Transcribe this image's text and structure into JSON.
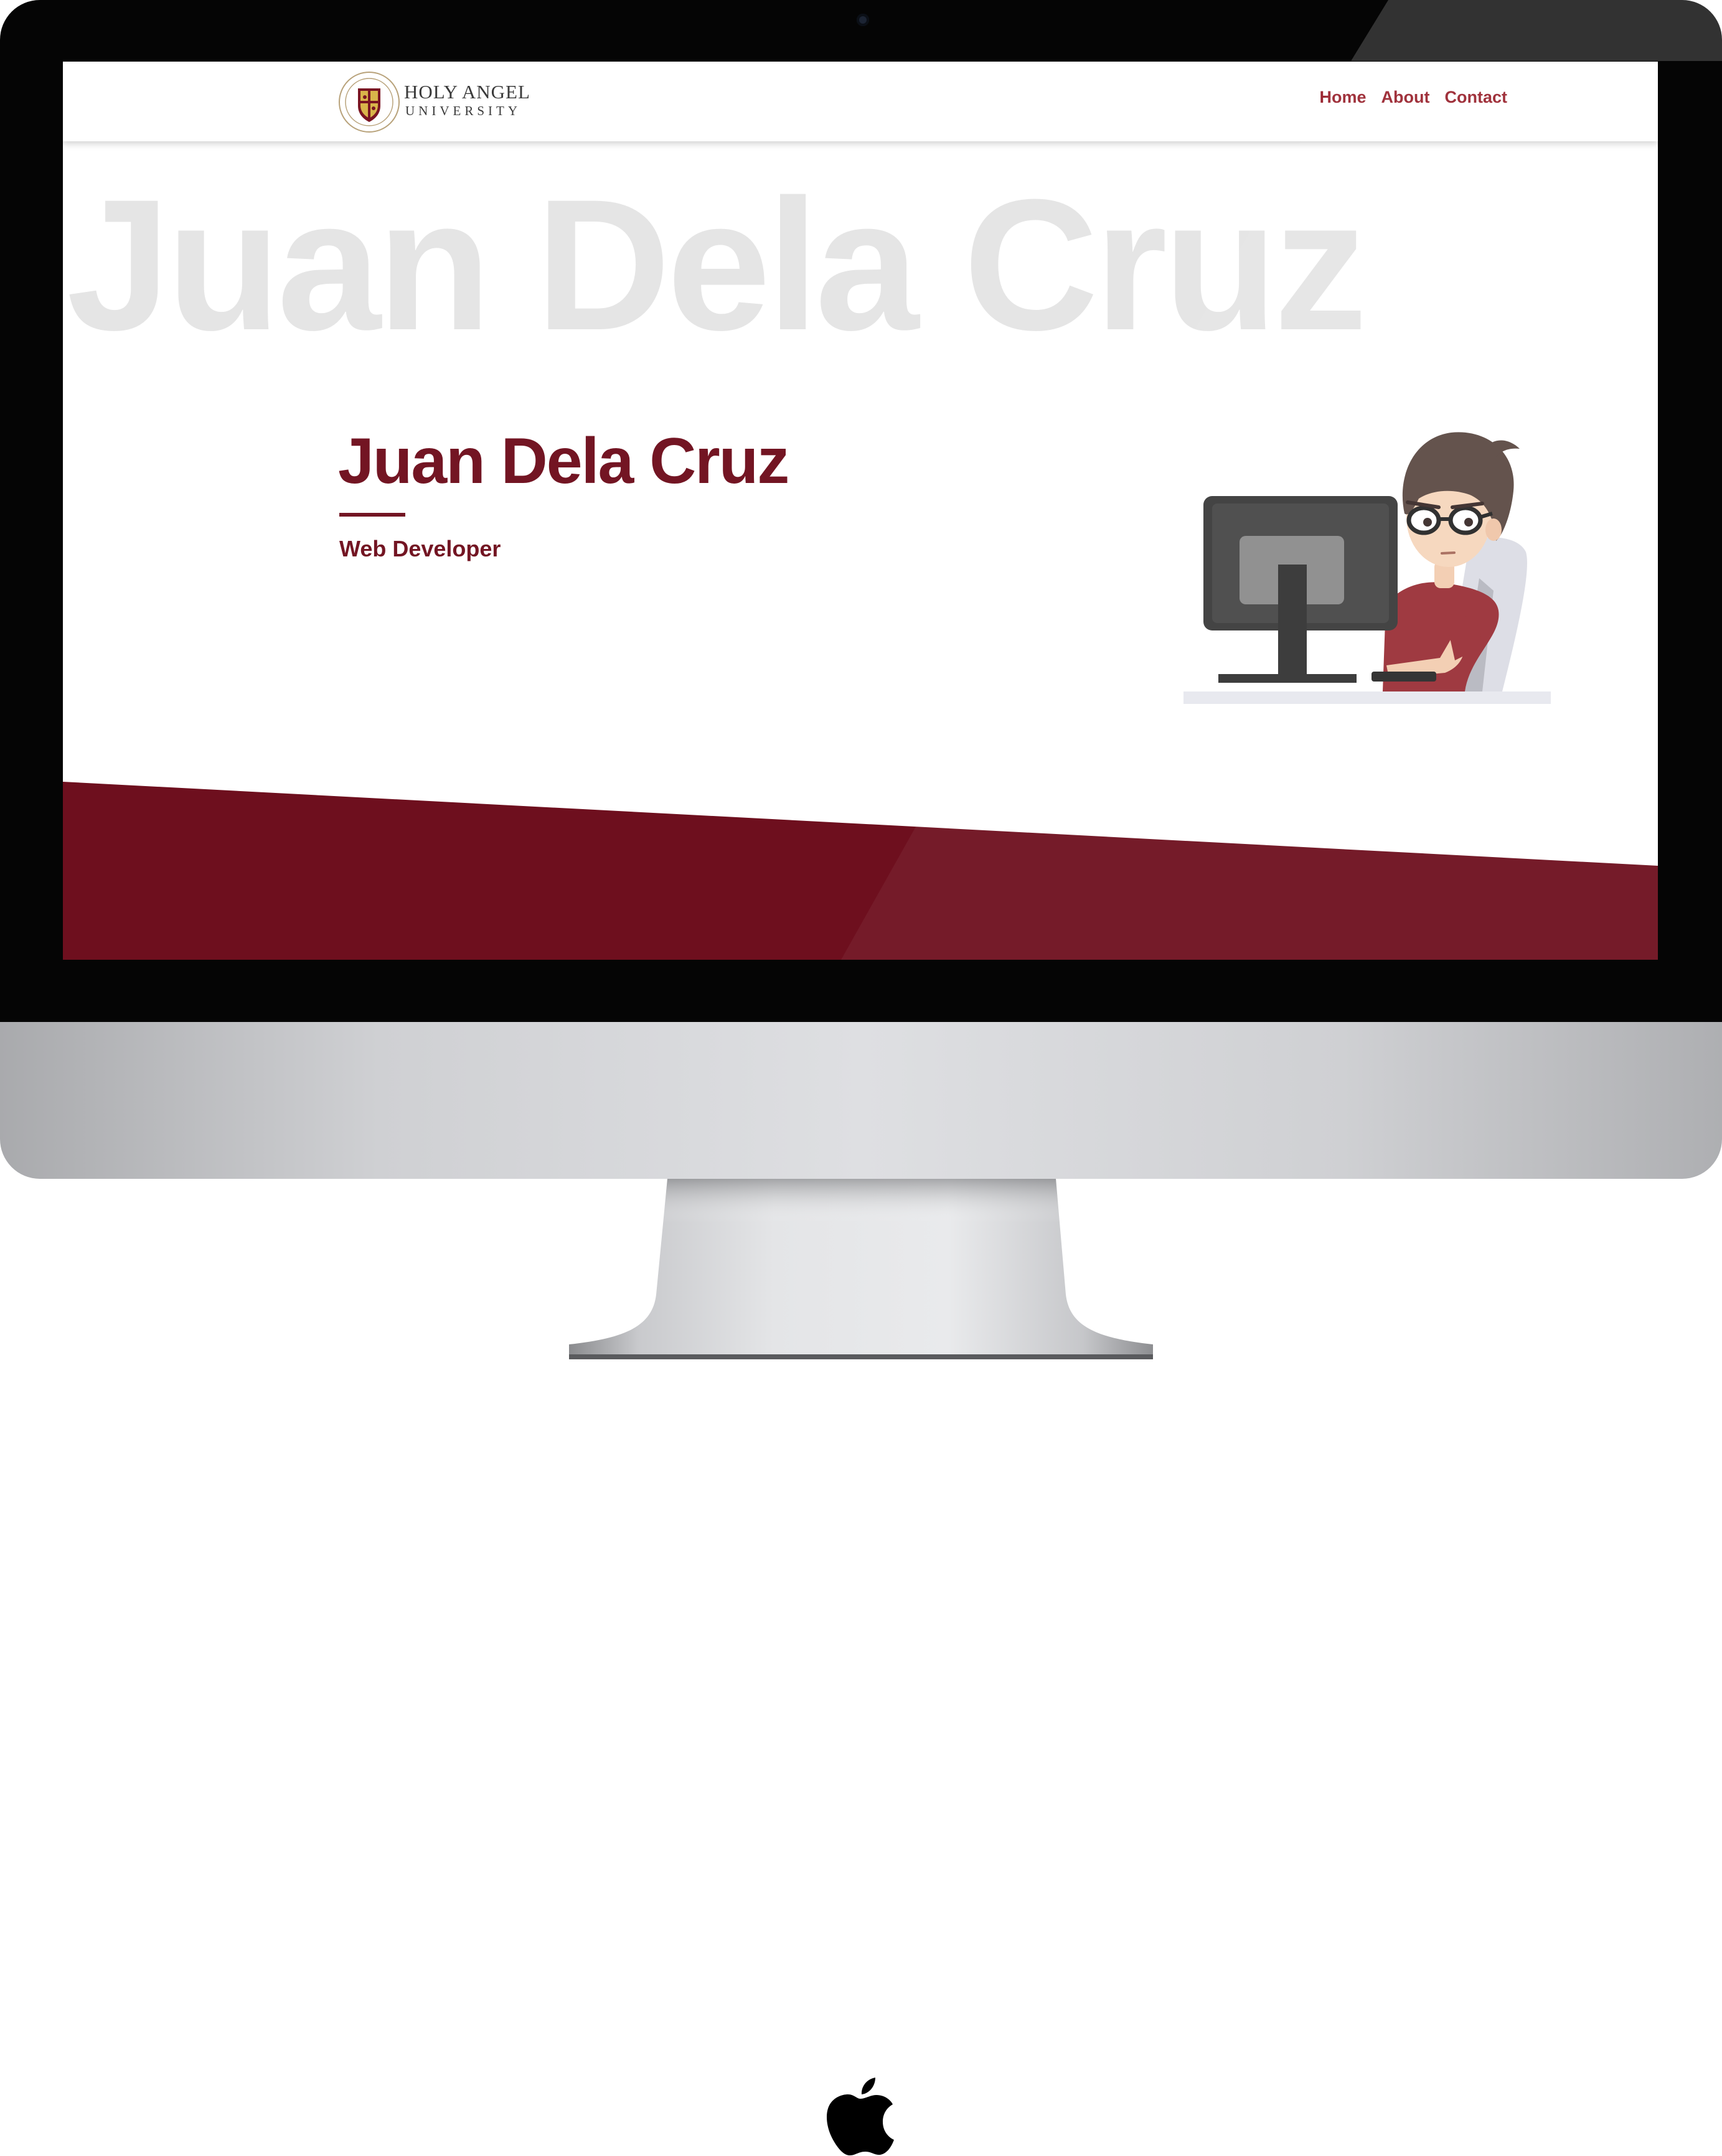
{
  "site": {
    "logo": {
      "line1": "HOLY ANGEL",
      "line2": "UNIVERSITY"
    },
    "nav": {
      "home": "Home",
      "about": "About",
      "contact": "Contact"
    },
    "hero": {
      "background_name": "Juan Dela Cruz",
      "title": "Juan Dela Cruz",
      "subtitle": "Web Developer"
    }
  },
  "colors": {
    "brand_maroon": "#731523",
    "nav_text": "#9b2732",
    "footer_band": "#6e0f1e",
    "background_name": "#e5e5e5"
  },
  "icons": {
    "device_logo": "apple-logo-icon",
    "illustration": "developer-at-computer-illustration"
  }
}
